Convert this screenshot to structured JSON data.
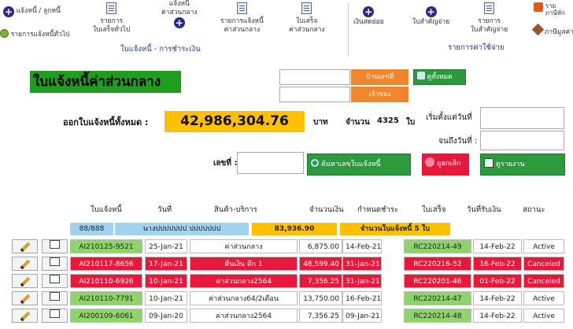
{
  "ribbon": {
    "debtor_label": "แจ้งหนี้ / ลูกหนี้",
    "list_all_label": "รายการแจ้งหนี้ทั่วไป",
    "receipt_general": [
      "รายการ",
      "ใบเสร็จทั่วไป"
    ],
    "debt_common": [
      "แจ้งหนี้",
      "ค่าส่วนกลาง"
    ],
    "debt_common_list": [
      "รายการแจ้งหนี้",
      "ค่าส่วนกลาง"
    ],
    "receipt_common": [
      "ใบเสร็จ",
      "ค่าส่วนกลาง"
    ],
    "group_debt": "ใบแจ้งหนี้ - การชำระเงิน",
    "petty_cash": "เงินสดย่อย",
    "payment_voucher": "ใบสำคัญจ่าย",
    "voucher_list": [
      "รายการ",
      "ใบสำคัญจ่าย"
    ],
    "group_expense": "รายการค่าใช้จ่าย",
    "tax": "ภาษีมูลค่า",
    "tax_top": [
      "ราย",
      "ภาษีหัก"
    ]
  },
  "page_title": "ใบแจ้งหนี้ค่าส่วนกลาง",
  "buttons": {
    "house_no": "บ้านเลขที่",
    "owner": "เจ้าของ",
    "show_all": "ดูทั้งหมด",
    "search": "ค้นหาเลขใบแจ้งหนี้",
    "clear": "ดูยกเลิก",
    "report": "ดูรายงาน"
  },
  "summary": {
    "issued_label": "ออกใบแจ้งหนี้ทั้งหมด :",
    "total": "42,986,304.76",
    "currency": "บาท",
    "count_label": "จำนวน",
    "count": "4325",
    "count_unit": "ใบ",
    "from_label": "เริ่มตั้งแต่วันที่",
    "to_label": "จนถึงวันที่ :",
    "doc_label": "เลขที่ :"
  },
  "table": {
    "headers": [
      "ใบแจ้งหนี้",
      "วันที่",
      "สินค้า-บริการ",
      "จำนวนเงิน",
      "กำหนดชำระ",
      "ใบเสร็จ",
      "วันที่รับเงิน",
      "สถานะ"
    ],
    "sum_row": {
      "page": "88/888",
      "name": "นางปปปปปปป ปปปปปปป",
      "amount": "83,936.90",
      "note": "จำนวนใบแจ้งหนี้ 5 ใบ"
    },
    "rows": [
      {
        "invoice": "AI210125-9521",
        "date": "25-Jan-21",
        "item": "ค่าส่วนกลาง",
        "amount": "6,875.00",
        "due": "14-Feb-21",
        "receipt": "RC220214-49",
        "paid": "14-Feb-22",
        "status": "Active",
        "state": "active"
      },
      {
        "invoice": "AI210117-8656",
        "date": "17-Jan-21",
        "item": "คืนเงิน ตึก 1",
        "amount": "48,599.40",
        "due": "31-Jan-21",
        "receipt": "RC220216-52",
        "paid": "16-Feb-22",
        "status": "Canceled",
        "state": "canceled"
      },
      {
        "invoice": "AI210110-6926",
        "date": "10-Jan-21",
        "item": "ค่าส่วนกลาง2564",
        "amount": "7,356.25",
        "due": "31-Jan-21",
        "receipt": "RC220201-46",
        "paid": "01-Feb-22",
        "status": "Canceled",
        "state": "canceled"
      },
      {
        "invoice": "AI210110-7791",
        "date": "10-Jan-21",
        "item": "ค่าส่วนกลาง64/2เดือน",
        "amount": "13,750.00",
        "due": "16-Feb-21",
        "receipt": "RC220214-47",
        "paid": "14-Feb-22",
        "status": "Active",
        "state": "active"
      },
      {
        "invoice": "AI200109-6061",
        "date": "09-Jan-20",
        "item": "ค่าส่วนกลาง2564",
        "amount": "7,356.25",
        "due": "09-Jan-21",
        "receipt": "RC220214-48",
        "paid": "14-Feb-22",
        "status": "Active",
        "state": "active"
      }
    ]
  },
  "colors": {
    "green": "#1f9d1f",
    "orange": "#f0862e",
    "gold": "#ffc000",
    "red": "#e8183b",
    "lightgreen": "#8fd46a",
    "sky": "#9fd3f0"
  }
}
